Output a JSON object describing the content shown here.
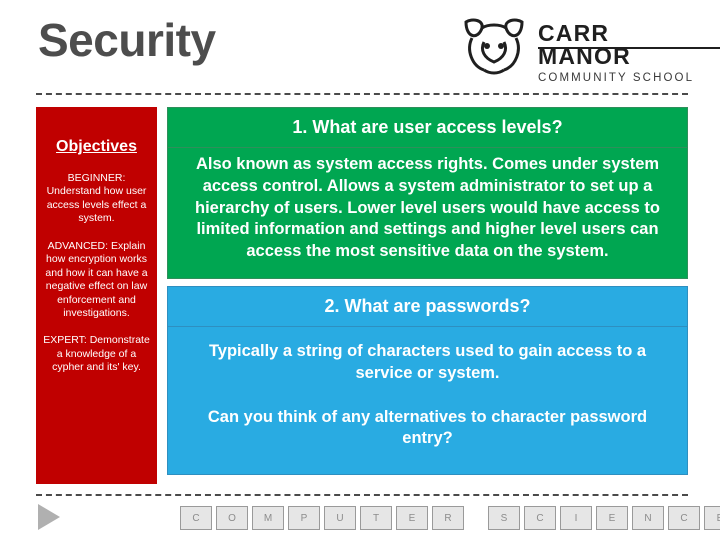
{
  "slide": {
    "title": "Security",
    "logo": {
      "name": "CARR MANOR",
      "subtitle": "COMMUNITY SCHOOL",
      "mark": "owl-logo-icon"
    },
    "objectives": {
      "heading": "Objectives",
      "items": [
        {
          "level": "BEGINNER:",
          "text": "Understand how user access levels effect a system."
        },
        {
          "level": "ADVANCED:",
          "text": "Explain how encryption works and how it can have a negative effect on law enforcement and investigations."
        },
        {
          "level": "EXPERT:",
          "text": "Demonstrate a knowledge of a cypher and its' key."
        }
      ]
    },
    "questions": [
      {
        "question": "1. What are user access levels?",
        "answers": [
          "Also known as system access rights. Comes under system access control. Allows a system administrator to set up a hierarchy of users. Lower level users would have access to limited information and settings and higher level users can access the most sensitive data on the system."
        ],
        "color": "#00a651"
      },
      {
        "question": "2. What are passwords?",
        "answers": [
          "Typically a string of characters used to gain access to a service or system.",
          "Can you think of any alternatives to character password entry?"
        ],
        "color": "#29abe2"
      }
    ],
    "footer": {
      "nav_icon": "play-triangle-icon",
      "tiles_group_one": [
        "C",
        "O",
        "M",
        "P",
        "U",
        "T",
        "E",
        "R"
      ],
      "tiles_group_two": [
        "S",
        "C",
        "I",
        "E",
        "N",
        "C",
        "E"
      ]
    }
  }
}
